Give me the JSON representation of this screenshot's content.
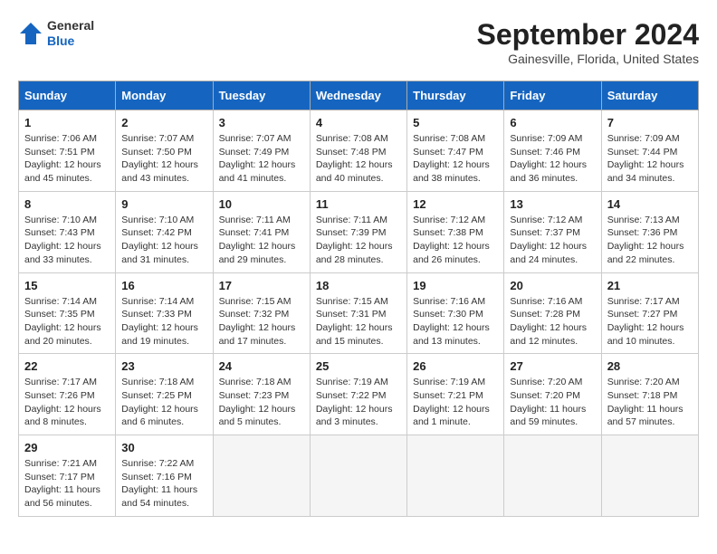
{
  "header": {
    "logo_line1": "General",
    "logo_line2": "Blue",
    "month": "September 2024",
    "location": "Gainesville, Florida, United States"
  },
  "days_of_week": [
    "Sunday",
    "Monday",
    "Tuesday",
    "Wednesday",
    "Thursday",
    "Friday",
    "Saturday"
  ],
  "weeks": [
    [
      {
        "num": "1",
        "sunrise": "7:06 AM",
        "sunset": "7:51 PM",
        "daylight": "12 hours and 45 minutes."
      },
      {
        "num": "2",
        "sunrise": "7:07 AM",
        "sunset": "7:50 PM",
        "daylight": "12 hours and 43 minutes."
      },
      {
        "num": "3",
        "sunrise": "7:07 AM",
        "sunset": "7:49 PM",
        "daylight": "12 hours and 41 minutes."
      },
      {
        "num": "4",
        "sunrise": "7:08 AM",
        "sunset": "7:48 PM",
        "daylight": "12 hours and 40 minutes."
      },
      {
        "num": "5",
        "sunrise": "7:08 AM",
        "sunset": "7:47 PM",
        "daylight": "12 hours and 38 minutes."
      },
      {
        "num": "6",
        "sunrise": "7:09 AM",
        "sunset": "7:46 PM",
        "daylight": "12 hours and 36 minutes."
      },
      {
        "num": "7",
        "sunrise": "7:09 AM",
        "sunset": "7:44 PM",
        "daylight": "12 hours and 34 minutes."
      }
    ],
    [
      {
        "num": "8",
        "sunrise": "7:10 AM",
        "sunset": "7:43 PM",
        "daylight": "12 hours and 33 minutes."
      },
      {
        "num": "9",
        "sunrise": "7:10 AM",
        "sunset": "7:42 PM",
        "daylight": "12 hours and 31 minutes."
      },
      {
        "num": "10",
        "sunrise": "7:11 AM",
        "sunset": "7:41 PM",
        "daylight": "12 hours and 29 minutes."
      },
      {
        "num": "11",
        "sunrise": "7:11 AM",
        "sunset": "7:39 PM",
        "daylight": "12 hours and 28 minutes."
      },
      {
        "num": "12",
        "sunrise": "7:12 AM",
        "sunset": "7:38 PM",
        "daylight": "12 hours and 26 minutes."
      },
      {
        "num": "13",
        "sunrise": "7:12 AM",
        "sunset": "7:37 PM",
        "daylight": "12 hours and 24 minutes."
      },
      {
        "num": "14",
        "sunrise": "7:13 AM",
        "sunset": "7:36 PM",
        "daylight": "12 hours and 22 minutes."
      }
    ],
    [
      {
        "num": "15",
        "sunrise": "7:14 AM",
        "sunset": "7:35 PM",
        "daylight": "12 hours and 20 minutes."
      },
      {
        "num": "16",
        "sunrise": "7:14 AM",
        "sunset": "7:33 PM",
        "daylight": "12 hours and 19 minutes."
      },
      {
        "num": "17",
        "sunrise": "7:15 AM",
        "sunset": "7:32 PM",
        "daylight": "12 hours and 17 minutes."
      },
      {
        "num": "18",
        "sunrise": "7:15 AM",
        "sunset": "7:31 PM",
        "daylight": "12 hours and 15 minutes."
      },
      {
        "num": "19",
        "sunrise": "7:16 AM",
        "sunset": "7:30 PM",
        "daylight": "12 hours and 13 minutes."
      },
      {
        "num": "20",
        "sunrise": "7:16 AM",
        "sunset": "7:28 PM",
        "daylight": "12 hours and 12 minutes."
      },
      {
        "num": "21",
        "sunrise": "7:17 AM",
        "sunset": "7:27 PM",
        "daylight": "12 hours and 10 minutes."
      }
    ],
    [
      {
        "num": "22",
        "sunrise": "7:17 AM",
        "sunset": "7:26 PM",
        "daylight": "12 hours and 8 minutes."
      },
      {
        "num": "23",
        "sunrise": "7:18 AM",
        "sunset": "7:25 PM",
        "daylight": "12 hours and 6 minutes."
      },
      {
        "num": "24",
        "sunrise": "7:18 AM",
        "sunset": "7:23 PM",
        "daylight": "12 hours and 5 minutes."
      },
      {
        "num": "25",
        "sunrise": "7:19 AM",
        "sunset": "7:22 PM",
        "daylight": "12 hours and 3 minutes."
      },
      {
        "num": "26",
        "sunrise": "7:19 AM",
        "sunset": "7:21 PM",
        "daylight": "12 hours and 1 minute."
      },
      {
        "num": "27",
        "sunrise": "7:20 AM",
        "sunset": "7:20 PM",
        "daylight": "11 hours and 59 minutes."
      },
      {
        "num": "28",
        "sunrise": "7:20 AM",
        "sunset": "7:18 PM",
        "daylight": "11 hours and 57 minutes."
      }
    ],
    [
      {
        "num": "29",
        "sunrise": "7:21 AM",
        "sunset": "7:17 PM",
        "daylight": "11 hours and 56 minutes."
      },
      {
        "num": "30",
        "sunrise": "7:22 AM",
        "sunset": "7:16 PM",
        "daylight": "11 hours and 54 minutes."
      },
      null,
      null,
      null,
      null,
      null
    ]
  ]
}
